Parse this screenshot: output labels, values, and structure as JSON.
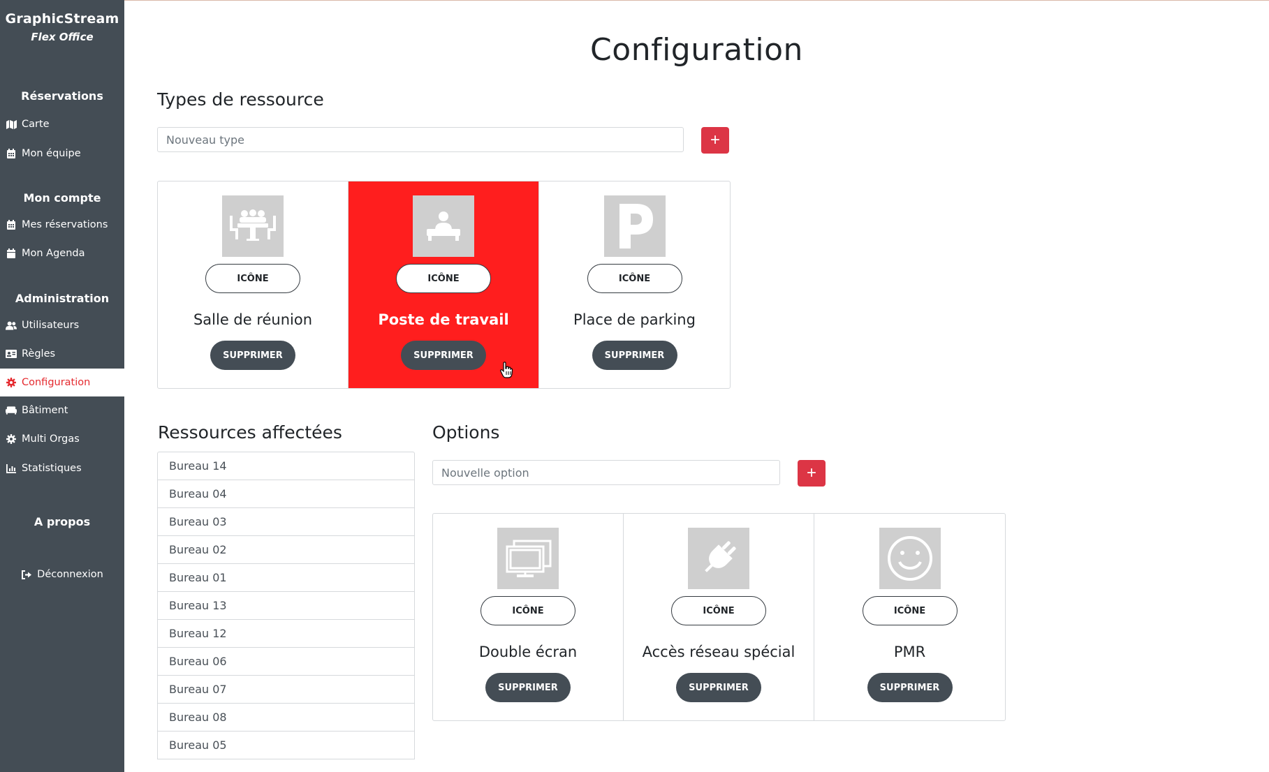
{
  "brand": {
    "name": "GraphicStream",
    "subtitle": "Flex Office"
  },
  "sidebar": {
    "sections": {
      "reservations": "Réservations",
      "account": "Mon compte",
      "admin": "Administration",
      "about": "A propos"
    },
    "items": {
      "map": {
        "label": "Carte",
        "icon": "map-icon"
      },
      "team": {
        "label": "Mon équipe",
        "icon": "calendar-icon"
      },
      "my_bookings": {
        "label": "Mes réservations",
        "icon": "calendar-icon"
      },
      "agenda": {
        "label": "Mon Agenda",
        "icon": "calendar-icon"
      },
      "users": {
        "label": "Utilisateurs",
        "icon": "users-icon"
      },
      "rules": {
        "label": "Règles",
        "icon": "id-card-icon"
      },
      "configuration": {
        "label": "Configuration",
        "icon": "gear-icon"
      },
      "building": {
        "label": "Bâtiment",
        "icon": "couch-icon"
      },
      "multi_orgs": {
        "label": "Multi Orgas",
        "icon": "gear-icon"
      },
      "stats": {
        "label": "Statistiques",
        "icon": "chart-icon"
      },
      "logout": {
        "label": "Déconnexion",
        "icon": "sign-out-icon"
      }
    }
  },
  "page": {
    "title": "Configuration"
  },
  "resource_types": {
    "heading": "Types de ressource",
    "input_placeholder": "Nouveau type",
    "add_label": "+",
    "items": [
      {
        "name": "Salle de réunion",
        "icon_btn": "ICÔNE",
        "delete_btn": "SUPPRIMER",
        "icon": "meeting-room-icon",
        "selected": false
      },
      {
        "name": "Poste de travail",
        "icon_btn": "ICÔNE",
        "delete_btn": "SUPPRIMER",
        "icon": "desk-icon",
        "selected": true
      },
      {
        "name": "Place de parking",
        "icon_btn": "ICÔNE",
        "delete_btn": "SUPPRIMER",
        "icon": "parking-icon",
        "selected": false
      }
    ]
  },
  "assigned_resources": {
    "heading": "Ressources affectées",
    "items": [
      "Bureau 14",
      "Bureau 04",
      "Bureau 03",
      "Bureau 02",
      "Bureau 01",
      "Bureau 13",
      "Bureau 12",
      "Bureau 06",
      "Bureau 07",
      "Bureau 08",
      "Bureau 05"
    ]
  },
  "options": {
    "heading": "Options",
    "input_placeholder": "Nouvelle option",
    "add_label": "+",
    "items": [
      {
        "name": "Double écran",
        "icon_btn": "ICÔNE",
        "delete_btn": "SUPPRIMER",
        "icon": "dual-screen-icon"
      },
      {
        "name": "Accès réseau spécial",
        "icon_btn": "ICÔNE",
        "delete_btn": "SUPPRIMER",
        "icon": "plug-icon"
      },
      {
        "name": "PMR",
        "icon_btn": "ICÔNE",
        "delete_btn": "SUPPRIMER",
        "icon": "smiley-icon"
      }
    ]
  },
  "colors": {
    "sidebar": "#444d55",
    "accent": "#dc3545",
    "selected_card": "#ff1e1e",
    "active_nav_text": "#e52a2f"
  }
}
